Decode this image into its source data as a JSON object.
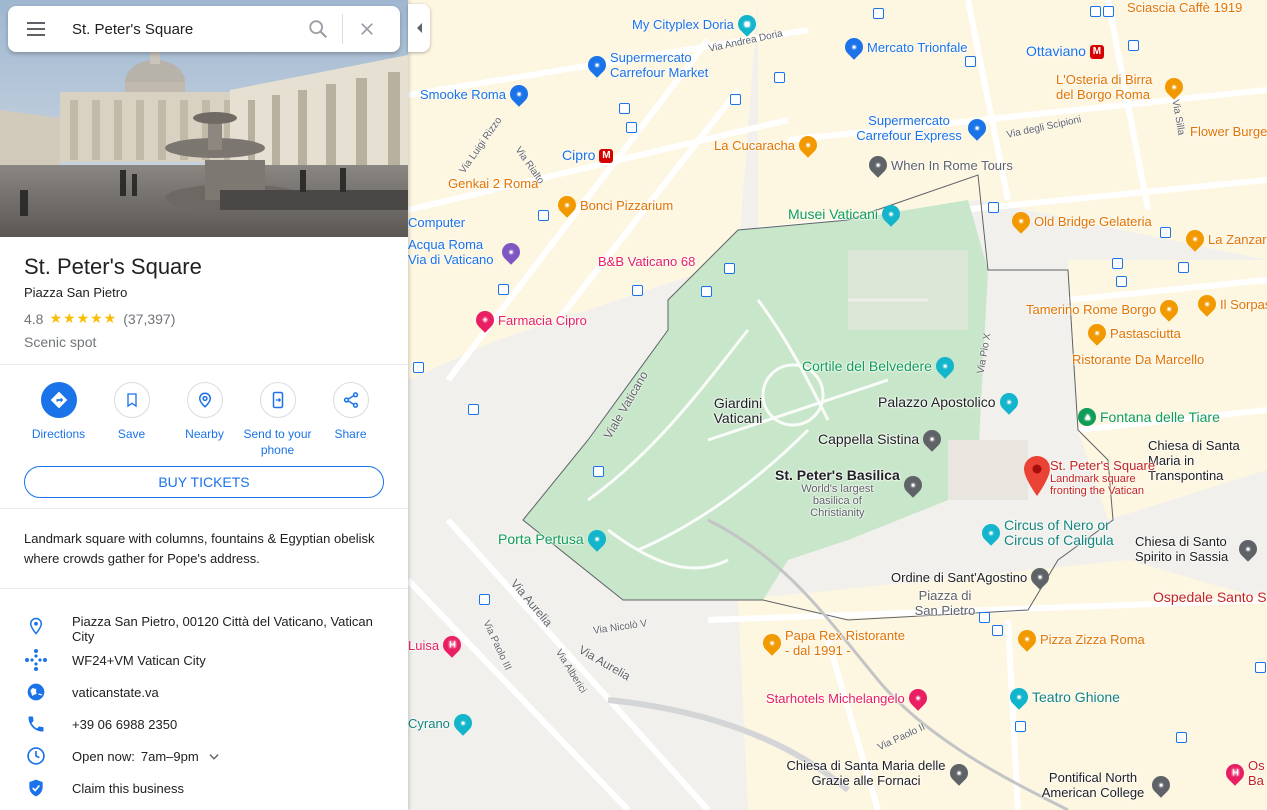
{
  "search": {
    "value": "St. Peter's Square"
  },
  "place": {
    "title": "St. Peter's Square",
    "subtitle": "Piazza San Pietro",
    "rating": "4.8",
    "stars": "★★★★★",
    "review_count": "(37,397)",
    "category": "Scenic spot",
    "description": "Landmark square with columns, fountains & Egyptian obelisk where crowds gather for Pope's address."
  },
  "actions": [
    {
      "label": "Directions",
      "icon": "directions-icon"
    },
    {
      "label": "Save",
      "icon": "bookmark-icon"
    },
    {
      "label": "Nearby",
      "icon": "nearby-icon"
    },
    {
      "label": "Send to your phone",
      "icon": "send-to-phone-icon"
    },
    {
      "label": "Share",
      "icon": "share-icon"
    }
  ],
  "buy_tickets_label": "BUY TICKETS",
  "details": {
    "address": "Piazza San Pietro, 00120 Città del Vaticano, Vatican City",
    "plus_code": "WF24+VM Vatican City",
    "website": "vaticanstate.va",
    "phone": "+39 06 6988 2350",
    "hours_prefix": "Open now:",
    "hours": "7am–9pm",
    "claim": "Claim this business"
  },
  "map": {
    "pois": [
      "My Cityplex Doria",
      "Sciascia Caffè 1919",
      "Supermercato Carrefour Market",
      "Mercato Trionfale",
      "Ottaviano",
      "L'Osteria di Birra del Borgo Roma",
      "Smooke Roma",
      "Supermercato Carrefour Express",
      "Flower Burger",
      "Cipro",
      "La Cucaracha",
      "When In Rome Tours",
      "Genkai 2 Roma",
      "Bonci Pizzarium",
      "Musei Vaticani",
      "Old Bridge Gelateria",
      "La Zanzara",
      "Computer",
      "Acqua Roma Via di Vaticano",
      "B&B Vaticano 68",
      "Il Sorpasso",
      "Tamerino Rome Borgo",
      "Farmacia Cipro",
      "Pastasciutta",
      "Cortile del Belvedere",
      "Ristorante Da Marcello",
      "Giardini Vaticani",
      "Palazzo Apostolico",
      "Fontana delle Tiare",
      "Cappella Sistina",
      "Chiesa di Santa Maria in Transpontina",
      "St. Peter's Basilica",
      "World's largest basilica of Christianity",
      "St. Peter's Square",
      "Landmark square fronting the Vatican",
      "Porta Pertusa",
      "Circus of Nero or Circus of Caligula",
      "Chiesa di Santo Spirito in Sassia",
      "Ordine di Sant'Agostino",
      "Piazza di San Pietro",
      "Ospedale Santo Spirito",
      "Papa Rex Ristorante - dal 1991 -",
      "Pizza Zizza Roma",
      "Luisa",
      "Teatro Ghione",
      "Starhotels Michelangelo",
      "Cyrano",
      "Chiesa di Santa Maria delle Grazie alle Fornaci",
      "Pontifical North American College",
      "Os Ba"
    ],
    "roads": [
      "Via Andrea Doria",
      "Via degli Scipioni",
      "Via Silla",
      "Via Luigi Rizzo",
      "Via Rialto",
      "Viale Vaticano",
      "Via Pio X",
      "Via Aurelia",
      "Via Paolo III",
      "Via Nicolò V",
      "Via Aurelia",
      "Via Alberici",
      "Via Paolo II"
    ]
  },
  "colors": {
    "accent": "#1a73e8",
    "star": "#fbbc04",
    "pin": "#ea4335",
    "park": "#c8e6c9"
  }
}
